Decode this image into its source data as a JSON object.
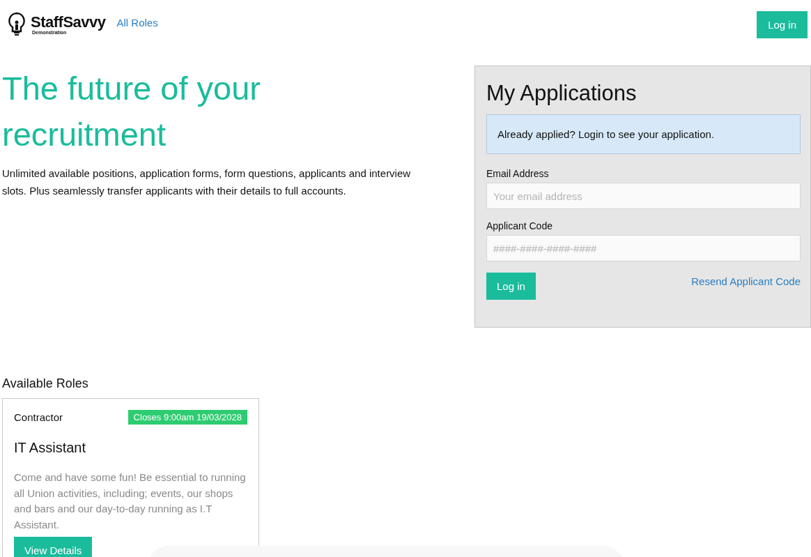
{
  "header": {
    "brand": "StaffSavvy",
    "brand_subtitle": "Demonstration",
    "nav_link": "All Roles",
    "login_button": "Log in"
  },
  "hero": {
    "title": "The future of your recruitment",
    "description": "Unlimited available positions, application forms, form questions, applicants and interview slots. Plus seamlessly transfer applicants with their details to full accounts."
  },
  "my_applications": {
    "title": "My Applications",
    "notice": "Already applied? Login to see your application.",
    "fields": [
      {
        "label": "Email Address",
        "placeholder": "Your email address"
      },
      {
        "label": "Applicant Code",
        "placeholder": "####-####-####-####"
      }
    ],
    "login_button": "Log in",
    "resend_link": "Resend Applicant Code"
  },
  "roles": {
    "heading": "Available Roles",
    "items": [
      {
        "type": "Contractor",
        "closes": "Closes 9:00am 19/03/2028",
        "title": "IT Assistant",
        "description": "Come and have some fun! Be essential to running all Union activities, including; events, our shops and bars and our day-to-day running as I.T Assistant.",
        "button": "View Details"
      }
    ]
  }
}
